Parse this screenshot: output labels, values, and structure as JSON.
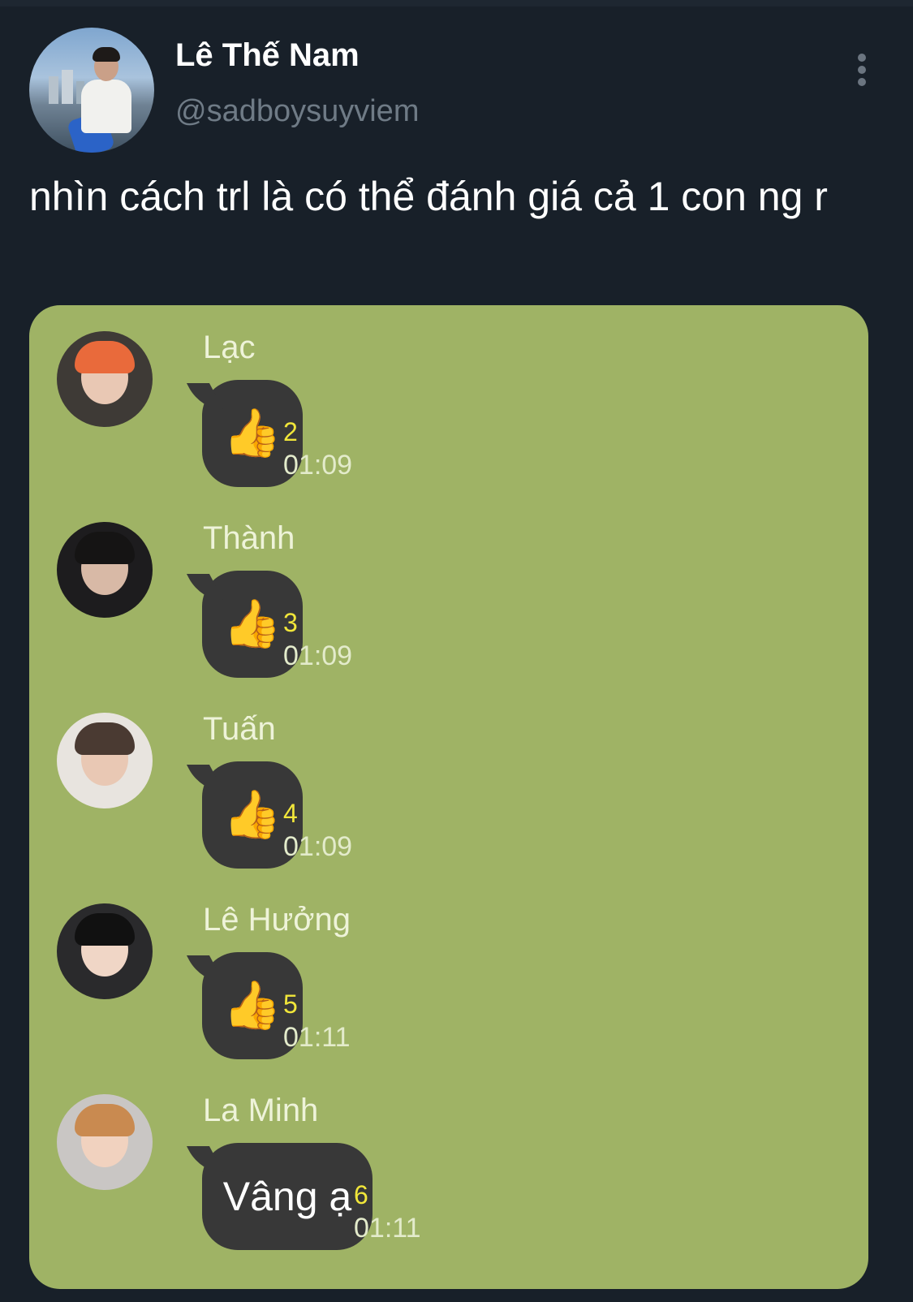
{
  "tweet": {
    "author_name": "Lê Thế Nam",
    "author_handle": "@sadboysuyviem",
    "text": "nhìn cách trl là có thể đánh giá cả 1 con ng r"
  },
  "chat": {
    "messages": [
      {
        "sender": "Lạc",
        "content": "👍",
        "read_count": "2",
        "time": "01:09"
      },
      {
        "sender": "Thành",
        "content": "👍",
        "read_count": "3",
        "time": "01:09"
      },
      {
        "sender": "Tuấn",
        "content": "👍",
        "read_count": "4",
        "time": "01:09"
      },
      {
        "sender": "Lê Hưởng",
        "content": "👍",
        "read_count": "5",
        "time": "01:11"
      },
      {
        "sender": "La Minh",
        "content": "Vâng ạ",
        "read_count": "6",
        "time": "01:11"
      }
    ]
  },
  "colors": {
    "background": "#182029",
    "chat_background": "#9fb365",
    "bubble": "#383838",
    "read_count": "#f1e63a",
    "handle": "#6f7b86"
  },
  "icons": {
    "more": "more-vertical-icon",
    "reaction": "thumbs-up-icon"
  }
}
